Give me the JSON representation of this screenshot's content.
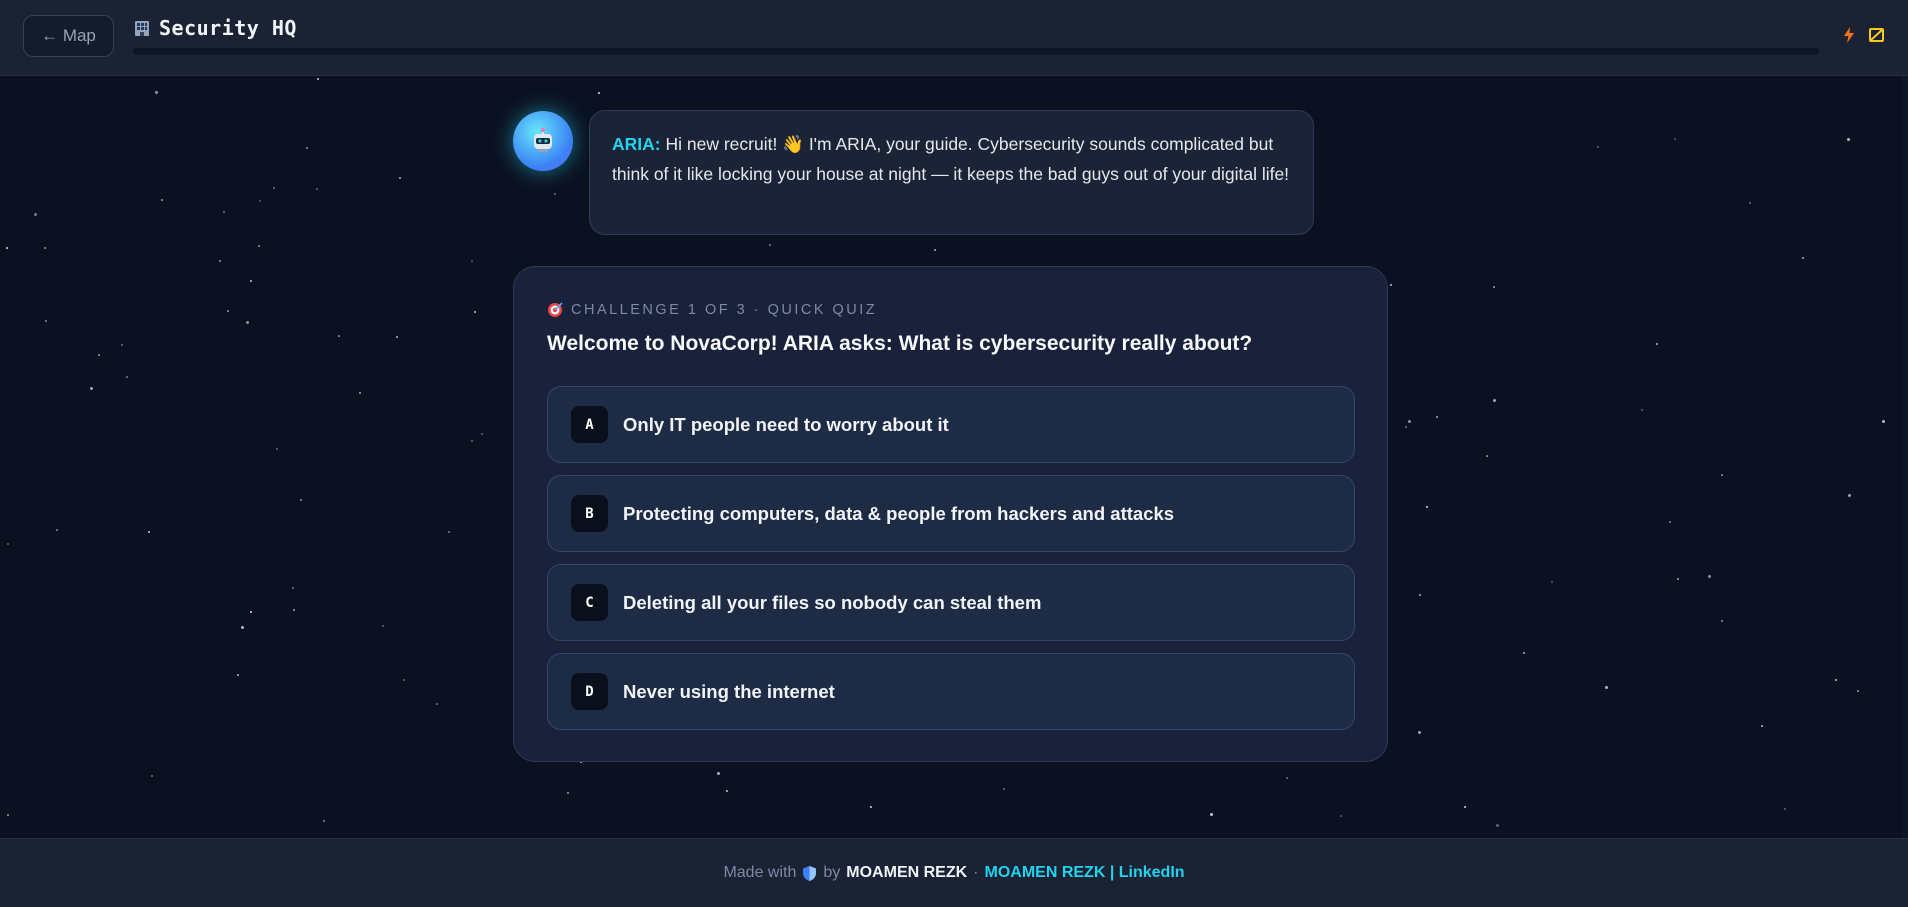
{
  "header": {
    "back_label": "← Map",
    "title": "Security HQ",
    "title_icon": "office-building-icon",
    "progress": 0,
    "icons": [
      "lightning-icon",
      "slashed-square-icon"
    ]
  },
  "aria": {
    "name": "ARIA:",
    "message": " Hi new recruit! 👋 I'm ARIA, your guide. Cybersecurity sounds complicated but think of it like locking your house at night — it keeps the bad guys out of your digital life!",
    "avatar_icon": "robot-icon"
  },
  "quiz": {
    "meta": "CHALLENGE 1 OF 3 · QUICK QUIZ",
    "meta_icon": "target-icon",
    "question": "Welcome to NovaCorp! ARIA asks: What is cybersecurity really about?",
    "options": [
      {
        "letter": "A",
        "text": "Only IT people need to worry about it"
      },
      {
        "letter": "B",
        "text": "Protecting computers, data & people from hackers and attacks"
      },
      {
        "letter": "C",
        "text": "Deleting all your files so nobody can steal them"
      },
      {
        "letter": "D",
        "text": "Never using the internet"
      }
    ]
  },
  "footer": {
    "made_with": "Made with",
    "by": "by",
    "author": "MOAMEN REZK",
    "separator": "·",
    "link": "MOAMEN REZK | LinkedIn"
  },
  "colors": {
    "background": "#0b1120",
    "accent": "#22d3ee",
    "card": "#19223a",
    "option": "#1e2b45"
  }
}
